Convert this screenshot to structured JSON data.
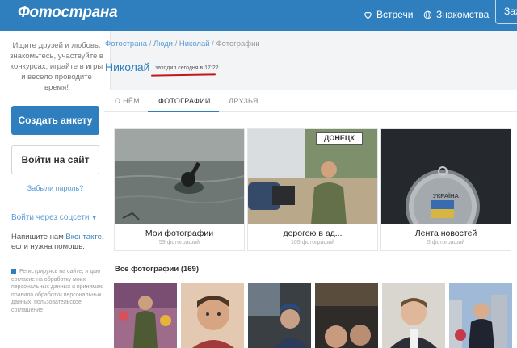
{
  "header": {
    "logo": "Фотострана",
    "nav": [
      {
        "label": "Встречи",
        "icon": "heart-icon"
      },
      {
        "label": "Знакомства",
        "icon": "globe-icon"
      }
    ],
    "login_label": "Заходи"
  },
  "sidebar": {
    "promo_text": "Ищите друзей и любовь, знакомьтесь, участвуйте в конкурсах, играйте в игры и весело проводите время!",
    "create_button": "Создать анкету",
    "login_button": "Войти на сайт",
    "forgot_link": "Забыли пароль?",
    "social_login": "Войти через соцсети",
    "write_us_prefix": "Напишите нам",
    "write_us_link": "Вконтакте",
    "write_us_suffix": ", если нужна помощь.",
    "consent_text": "Регистрируясь на сайте, я даю согласие на обработку моих персональных данных и принимаю правила обработки персональных данных, пользовательское соглашение"
  },
  "breadcrumb": {
    "items": [
      "Фотострана",
      "Люди",
      "Николай"
    ],
    "current": "Фотографии"
  },
  "profile": {
    "name": "Николай",
    "last_seen": "заходил сегодня в 17:22"
  },
  "tabs": [
    {
      "label": "О НЁМ",
      "active": false
    },
    {
      "label": "ФОТОГРАФИИ",
      "active": true
    },
    {
      "label": "ДРУЗЬЯ",
      "active": false
    }
  ],
  "albums": [
    {
      "title": "Мои фотографии",
      "count": "59 фотографий"
    },
    {
      "title": "дорогою в ад...",
      "count": "105 фотографий",
      "sign_text": "ДОНЕЦК"
    },
    {
      "title": "Лента новостей",
      "count": "5 фотографий",
      "medal_text": "УКРАЇНА"
    }
  ],
  "all_photos_label": "Все фотографии (169)",
  "colors": {
    "brand_blue": "#2f7fbf",
    "link_blue": "#5a9bd5",
    "highlight_red": "#c0181e"
  }
}
